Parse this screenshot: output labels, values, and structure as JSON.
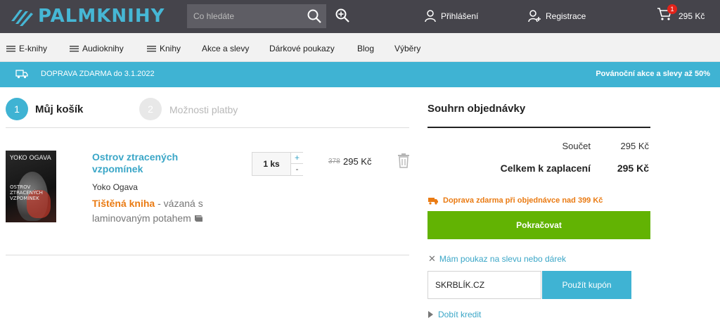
{
  "header": {
    "logo_text": "PALMKNIHY",
    "search_placeholder": "Co hledáte",
    "login_label": "Přihlášení",
    "register_label": "Registrace",
    "cart_count": "1",
    "cart_total": "295 Kč",
    "icons": [
      "logo-icon",
      "search-icon",
      "zoom-in-icon",
      "user-icon",
      "user-add-icon",
      "cart-icon"
    ]
  },
  "nav": {
    "items": [
      {
        "label": "E-knihy",
        "icon": "menu-icon"
      },
      {
        "label": "Audioknihy",
        "icon": "menu-icon"
      },
      {
        "label": "Knihy",
        "icon": "menu-icon"
      },
      {
        "label": "Akce a slevy"
      },
      {
        "label": "Dárkové poukazy"
      },
      {
        "label": "Blog"
      },
      {
        "label": "Výběry"
      }
    ]
  },
  "promo": {
    "left": "DOPRAVA ZDARMA do 3.1.2022",
    "right": "Povánoční akce a slevy až 50%",
    "accent": "#3fb3d3"
  },
  "steps": [
    {
      "number": "1",
      "label": "Můj košík"
    },
    {
      "number": "2",
      "label": "Možnosti platby"
    }
  ],
  "cart_item": {
    "cover_author": "YOKO OGAVA",
    "cover_title": "OSTROV ZTRACENÝCH VZPOMÍNEK",
    "title": "Ostrov ztracených vzpomínek",
    "author": "Yoko Ogava",
    "format": "Tištěná kniha",
    "format_detail": " - vázaná s laminovaným potahem",
    "quantity": "1 ks",
    "plus": "+",
    "minus": "-",
    "old_price": "378",
    "price": "295 Kč"
  },
  "summary": {
    "title": "Souhrn objednávky",
    "subtotal_label": "Součet",
    "subtotal_value": "295 Kč",
    "total_label": "Celkem k zaplacení",
    "total_value": "295 Kč",
    "shipping_note": "Doprava zdarma při objednávce nad 399 Kč",
    "continue_label": "Pokračovat",
    "voucher_link": "Mám poukaz na slevu nebo dárek",
    "coupon_value": "SKRBLÍK.CZ",
    "coupon_button": "Použít kupón",
    "credit_link": "Dobít kredit",
    "continue_color": "#62b303",
    "shipping_color": "#ea7b13"
  }
}
